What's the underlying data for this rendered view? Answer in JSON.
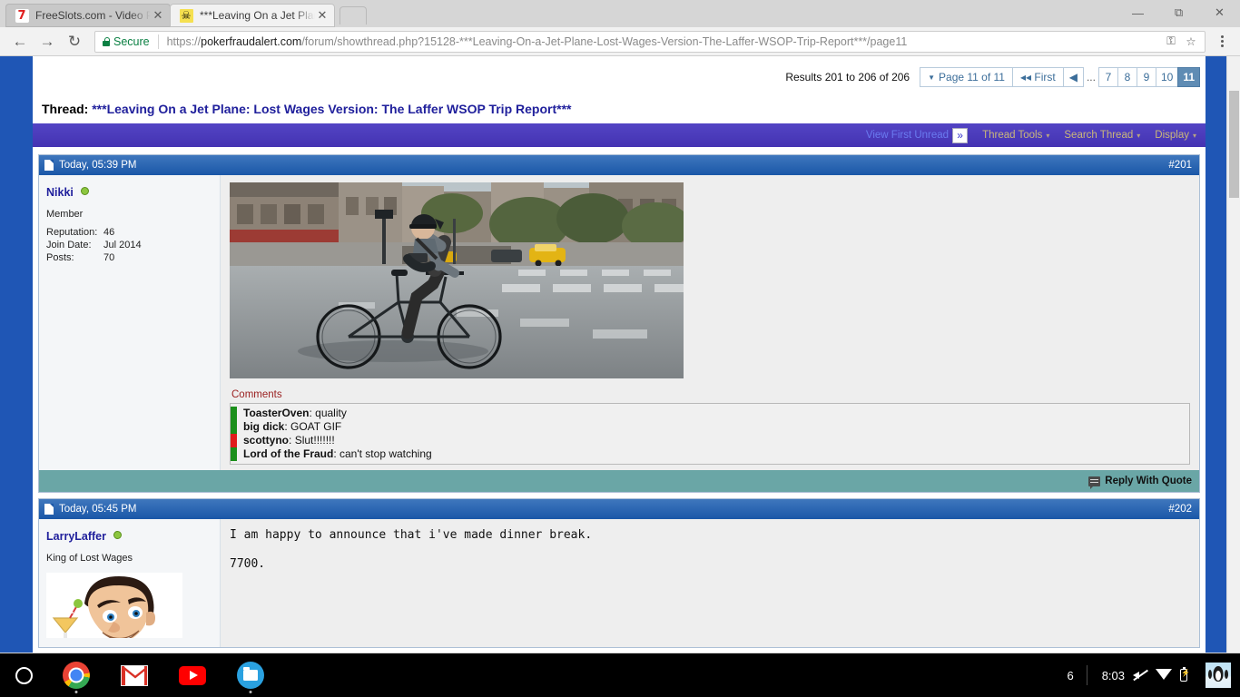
{
  "browser": {
    "tabs": [
      {
        "title": "FreeSlots.com - Video Po",
        "favicon": "seven-icon",
        "active": false
      },
      {
        "title": "***Leaving On a Jet Plan",
        "favicon": "skull-icon",
        "active": true
      }
    ],
    "window_controls": {
      "minimize": "—",
      "maximize": "❑",
      "close": "✕"
    },
    "nav": {
      "back": "←",
      "forward": "→",
      "reload": "↻"
    },
    "omnibox": {
      "security_label": "Secure",
      "url_scheme": "https://",
      "url_host": "pokerfraudalert.com",
      "url_path": "/forum/showthread.php?15128-***Leaving-On-a-Jet-Plane-Lost-Wages-Version-The-Laffer-WSOP-Trip-Report***/page11",
      "key_icon": "key-icon",
      "star_icon": "star-icon"
    },
    "menu_icon": "three-dot-menu-icon"
  },
  "pagination": {
    "results": "Results 201 to 206 of 206",
    "page_selector": "Page 11 of 11",
    "first_label": "First",
    "prev_label": "◀",
    "ellipsis": "...",
    "pages": [
      "7",
      "8",
      "9",
      "10",
      "11"
    ],
    "current_page": "11"
  },
  "thread": {
    "label": "Thread:",
    "title": "***Leaving On a Jet Plane: Lost Wages Version: The Laffer WSOP Trip Report***"
  },
  "toolbar": {
    "view_first_unread": "View First Unread",
    "thread_tools": "Thread Tools",
    "search_thread": "Search Thread",
    "display": "Display",
    "caret": "⌄"
  },
  "posts": [
    {
      "timestamp": "Today, 05:39 PM",
      "number": "#201",
      "user": {
        "name": "Nikki",
        "title": "Member",
        "stats": [
          {
            "key": "Reputation:",
            "value": "46"
          },
          {
            "key": "Join Date:",
            "value": "Jul 2014"
          },
          {
            "key": "Posts:",
            "value": "70"
          }
        ]
      },
      "attachment": "cyclist-street-gif",
      "comments_label": "Comments",
      "comments": [
        {
          "name": "ToasterOven",
          "text": "quality",
          "color": "green"
        },
        {
          "name": "big dick",
          "text": "GOAT GIF",
          "color": "green"
        },
        {
          "name": "scottyno",
          "text": "Slut!!!!!!!",
          "color": "red"
        },
        {
          "name": "Lord of the Fraud",
          "text": "can't stop watching",
          "color": "green"
        }
      ],
      "reply_label": "Reply With Quote"
    },
    {
      "timestamp": "Today, 05:45 PM",
      "number": "#202",
      "user": {
        "name": "LarryLaffer",
        "title": "King of Lost Wages",
        "avatar": "cartoon-man-cocktail-avatar",
        "stats": []
      },
      "body_lines": [
        "I am happy to announce that i've made dinner break.",
        "7700."
      ]
    }
  ],
  "shelf": {
    "launcher_icon": "launcher-circle-icon",
    "apps": [
      {
        "name": "chrome-icon"
      },
      {
        "name": "gmail-icon"
      },
      {
        "name": "youtube-icon"
      },
      {
        "name": "files-icon"
      }
    ],
    "window_count": "6",
    "time": "8:03",
    "volume_icon": "volume-muted-icon",
    "wifi_icon": "wifi-icon",
    "battery_icon": "battery-charging-icon",
    "avatar": "penguin-avatar"
  },
  "colors": {
    "page_bg": "#1f56b5",
    "post_header": "#1a57a8",
    "purple_bar": "#4b3bbd",
    "reply_bar": "#6aa6a6",
    "link": "#20209c",
    "comment_green": "#1a8f1a",
    "comment_red": "#e01b1b"
  }
}
